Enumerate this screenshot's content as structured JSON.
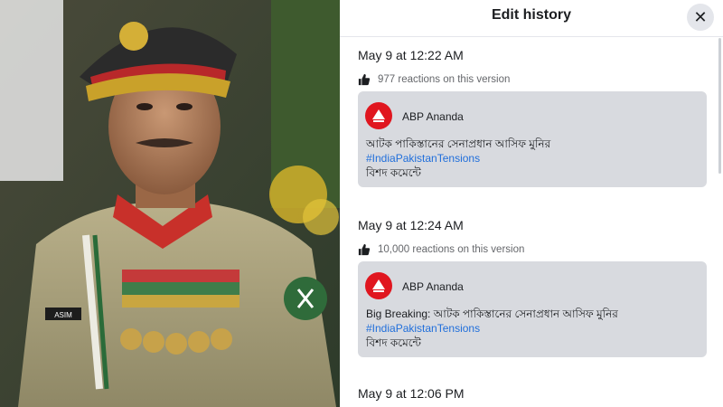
{
  "header": {
    "title": "Edit history",
    "close_icon": "close-icon"
  },
  "photo": {
    "nametag": "ASIM"
  },
  "versions": [
    {
      "timestamp": "May 9 at 12:22 AM",
      "reactions": "977 reactions on this version",
      "author": "ABP Ananda",
      "lines": [
        "আটক পাকিস্তানের সেনাপ্রধান আসিফ মুনির",
        "#IndiaPakistanTensions",
        "বিশদ কমেন্টে"
      ]
    },
    {
      "timestamp": "May 9 at 12:24 AM",
      "reactions": "10,000 reactions on this version",
      "author": "ABP Ananda",
      "lines": [
        "Big Breaking: আটক পাকিস্তানের সেনাপ্রধান আসিফ মুনির",
        "#IndiaPakistanTensions",
        "বিশদ কমেন্টে"
      ]
    },
    {
      "timestamp": "May 9 at 12:06 PM"
    }
  ],
  "colors": {
    "hashtag": "#216fdb",
    "card_bg": "#d8dadf",
    "logo_red": "#e0161f"
  }
}
